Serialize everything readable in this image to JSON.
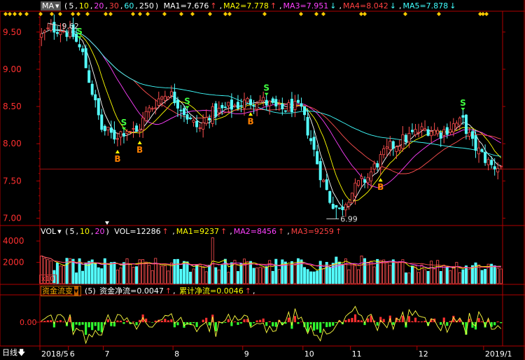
{
  "chart_data": {
    "type": "candlestick",
    "price_panel": {
      "indicator_name": "MA",
      "params": "(5,10,20,30,60,250)",
      "ma_values": [
        {
          "label": "MA1=7.676",
          "color": "#ffffff",
          "arrow": "↑",
          "arrow_color": "#ff4040"
        },
        {
          "label": "MA2=7.778",
          "color": "#ffff00",
          "arrow": "↑",
          "arrow_color": "#ff4040"
        },
        {
          "label": "MA3=7.951",
          "color": "#ff40ff",
          "arrow": "↓",
          "arrow_color": "#40ffff"
        },
        {
          "label": "MA4=8.042",
          "color": "#ff4040",
          "arrow": "↓",
          "arrow_color": "#40ffff"
        },
        {
          "label": "MA5=7.878",
          "color": "#40ffff",
          "arrow": "↓",
          "arrow_color": "#40ffff"
        }
      ],
      "y_ticks": [
        "9.50",
        "9.00",
        "8.50",
        "8.00",
        "7.50",
        "7.00"
      ],
      "ylim": [
        6.92,
        9.78
      ],
      "high_annotation": "9.62",
      "low_annotation": "6.99",
      "signals": [
        {
          "type": "S",
          "bar": 12
        },
        {
          "type": "B",
          "bar": 24
        },
        {
          "type": "S",
          "bar": 26
        },
        {
          "type": "B",
          "bar": 31
        },
        {
          "type": "S",
          "bar": 46
        },
        {
          "type": "B",
          "bar": 66
        },
        {
          "type": "S",
          "bar": 71
        },
        {
          "type": "B",
          "bar": 107
        },
        {
          "type": "S",
          "bar": 133
        }
      ]
    },
    "volume_panel": {
      "indicator_name": "VOL",
      "params": "(5,10,20)",
      "vol_value": "VOL=12286",
      "ma_values": [
        {
          "label": "MA1=9237",
          "color": "#ffff00"
        },
        {
          "label": "MA2=8456",
          "color": "#ff40ff"
        },
        {
          "label": "MA3=9259",
          "color": "#ff4040"
        }
      ],
      "y_ticks": [
        "4000",
        "2000"
      ],
      "unit": "x10",
      "ylim": [
        0,
        4400
      ]
    },
    "flow_panel": {
      "indicator_name": "资金流变",
      "params": "(5)",
      "net_flow": "资金净流=0.0047",
      "cumulative_flow": "累计净流=0.0046",
      "y_ticks": [
        "0.00"
      ]
    },
    "x_axis": {
      "period_label": "日线",
      "ticks": [
        {
          "label": "2018/5",
          "bar": 0
        },
        {
          "label": "6",
          "bar": 9
        },
        {
          "label": "7",
          "bar": 20
        },
        {
          "label": "8",
          "bar": 42
        },
        {
          "label": "9",
          "bar": 64
        },
        {
          "label": "10",
          "bar": 83
        },
        {
          "label": "11",
          "bar": 98
        },
        {
          "label": "12",
          "bar": 119
        },
        {
          "label": "2019/1",
          "bar": 140
        }
      ]
    },
    "n_bars": 146,
    "colors": {
      "up": "#ff5050",
      "down": "#54ffff",
      "axis": "#b00000",
      "grid": "#5a0000",
      "tick_text": "#ff3030"
    }
  }
}
